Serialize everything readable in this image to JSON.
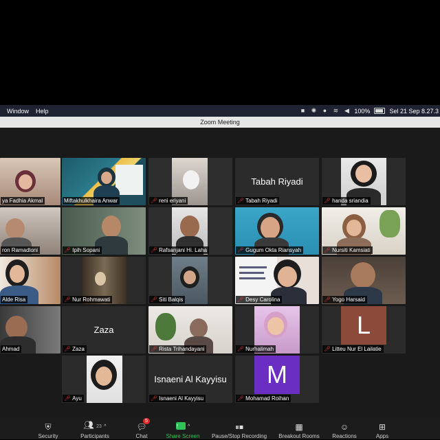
{
  "menubar": {
    "menus": [
      "Window",
      "Help"
    ],
    "battery": "100%",
    "datetime": "Sel 21 Sep  8.27.3"
  },
  "window": {
    "title": "Zoom Meeting"
  },
  "participants": [
    {
      "name": "ya Fadhia Akmal",
      "muted": false,
      "active": true
    },
    {
      "name": "Miftakhulkhaira Anwar",
      "muted": false
    },
    {
      "name": "reni eriyani",
      "muted": true
    },
    {
      "name": "Tabah Riyadi",
      "muted": true,
      "display_name": "Tabah Riyadi"
    },
    {
      "name": "handa sriandia",
      "muted": true
    },
    {
      "name": "ron Ramadloni",
      "muted": false
    },
    {
      "name": "Ipih Sopani",
      "muted": true
    },
    {
      "name": "Rafsanjani Hi. Laha",
      "muted": true
    },
    {
      "name": "Gugum Okta Riansyah",
      "muted": true
    },
    {
      "name": "Nursiti Kamsiati",
      "muted": true
    },
    {
      "name": "Alde Risa",
      "muted": false
    },
    {
      "name": "Nur Rohmawati",
      "muted": true
    },
    {
      "name": "Siti Balqis",
      "muted": true
    },
    {
      "name": "Desy Carolina",
      "muted": true
    },
    {
      "name": "Yogo Harsaid",
      "muted": true
    },
    {
      "name": "Ahmad",
      "muted": false
    },
    {
      "name": "Zaza",
      "muted": true,
      "display_name": "Zaza"
    },
    {
      "name": "Rista Trihandayani",
      "muted": true
    },
    {
      "name": "Nurhalimah",
      "muted": true
    },
    {
      "name": "Litteu Nur El Lailatie",
      "muted": true,
      "avatar_letter": "L"
    },
    {
      "name": "Ayu",
      "muted": true
    },
    {
      "name": "Isnaeni Al Kayyisu",
      "muted": true,
      "display_name": "Isnaeni Al Kayyisu"
    },
    {
      "name": "Mohamad Roihan",
      "muted": true,
      "avatar_letter": "M"
    }
  ],
  "toolbar": {
    "security": "Security",
    "participants": "Participants",
    "participants_count": "23",
    "chat": "Chat",
    "chat_badge": "5",
    "share_screen": "Share Screen",
    "pause_recording": "Pause/Stop Recording",
    "breakout_rooms": "Breakout Rooms",
    "reactions": "Reactions",
    "apps": "Apps"
  },
  "colors": {
    "active_speaker": "#c8d94a",
    "share_green": "#2fc25b",
    "muted_red": "#e23b3b",
    "letter_L_bg": "#8b4a3a",
    "letter_M_bg": "#6a2fc2"
  }
}
